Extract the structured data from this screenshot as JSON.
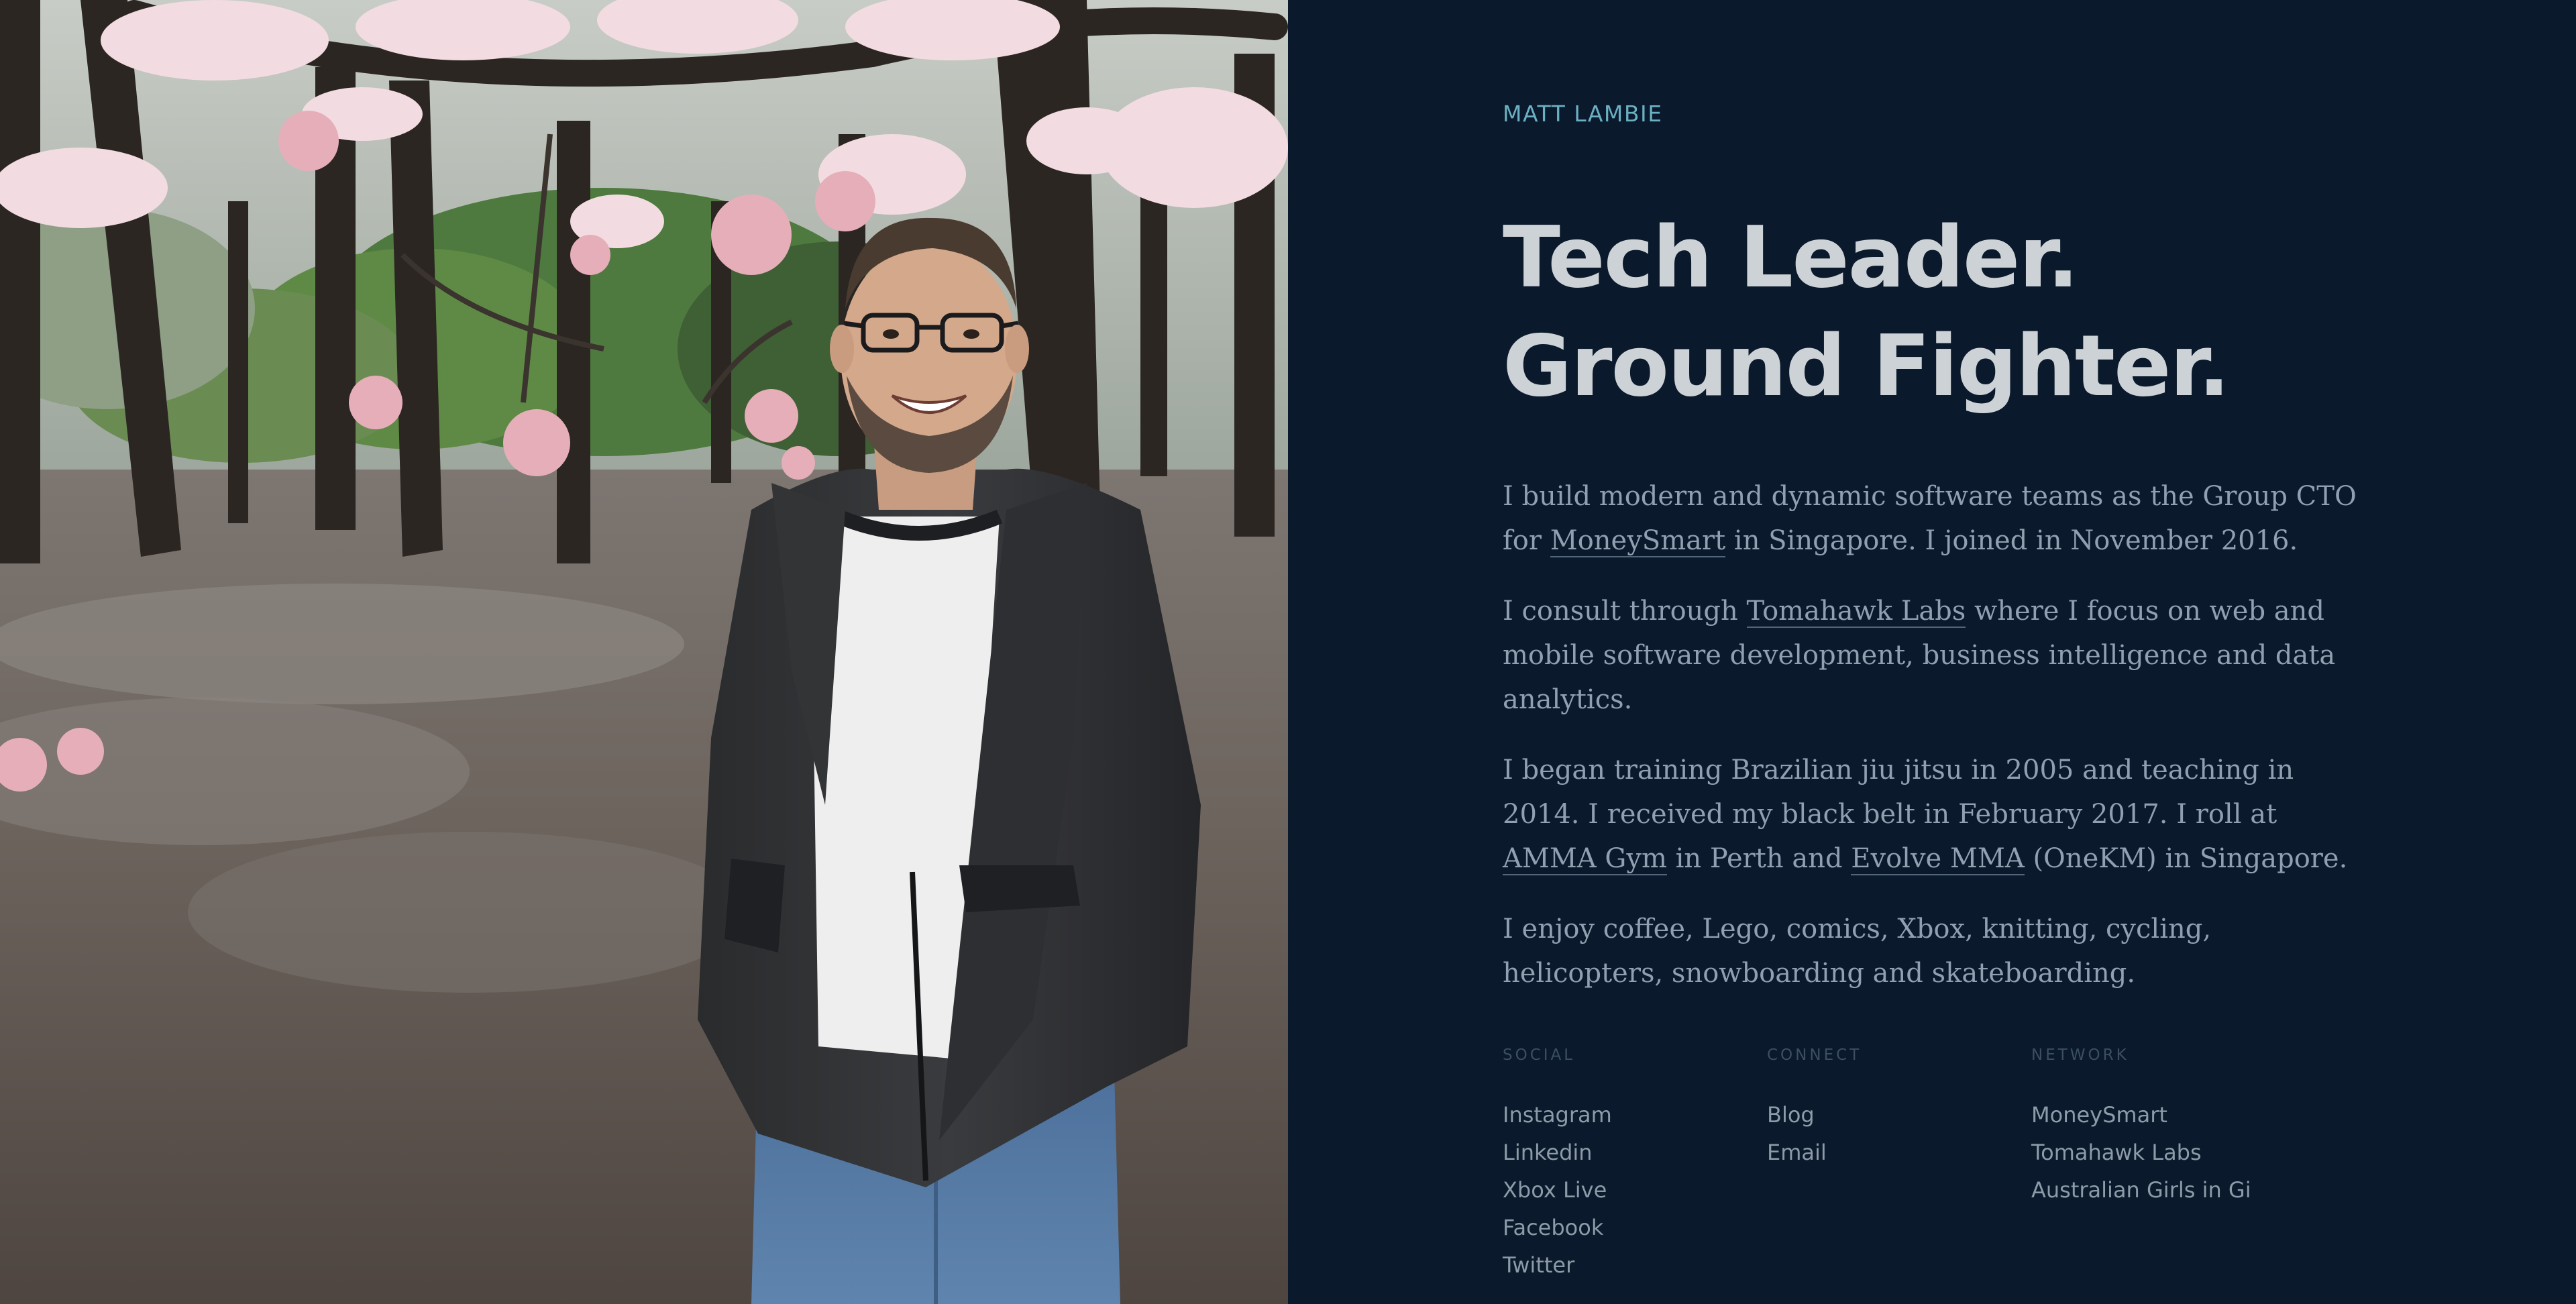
{
  "profile": {
    "name": "MATT LAMBIE",
    "headline_line1": "Tech Leader.",
    "headline_line2": "Ground Fighter."
  },
  "bio": {
    "p1": {
      "before": "I build modern and dynamic software teams as the Group CTO for ",
      "link": "MoneySmart",
      "after": " in Singapore. I joined in November 2016."
    },
    "p2": {
      "before": "I consult through ",
      "link": "Tomahawk Labs",
      "after": " where I focus on web and mobile software development, business intelligence and data analytics."
    },
    "p3": {
      "before": "I began training Brazilian jiu jitsu in 2005 and teaching in 2014. I received my black belt in February 2017. I roll at ",
      "link1": "AMMA Gym",
      "middle": " in Perth and ",
      "link2": "Evolve MMA",
      "after": " (OneKM) in Singapore."
    },
    "p4": "I enjoy coffee, Lego, comics, Xbox, knitting, cycling, helicopters, snowboarding and skateboarding."
  },
  "social": {
    "title": "SOCIAL",
    "items": [
      "Instagram",
      "Linkedin",
      "Xbox Live",
      "Facebook",
      "Twitter"
    ]
  },
  "connect": {
    "title": "CONNECT",
    "items": [
      "Blog",
      "Email"
    ]
  },
  "network": {
    "title": "NETWORK",
    "items": [
      "MoneySmart",
      "Tomahawk Labs",
      "Australian Girls in Gi"
    ]
  },
  "colors": {
    "background": "#0a192b",
    "accent": "#6bb0c2",
    "headline": "#cdd2d6",
    "body_text": "#8fa0b0"
  }
}
